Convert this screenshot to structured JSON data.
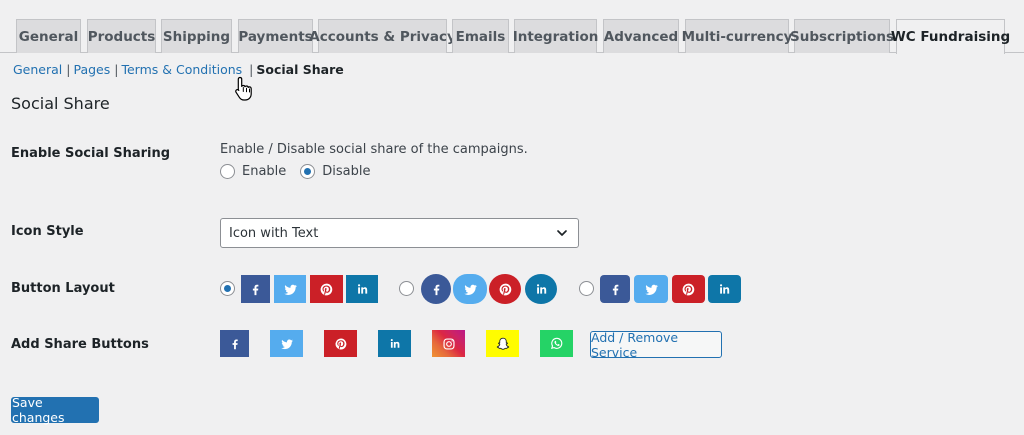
{
  "tabs": [
    {
      "label": "General"
    },
    {
      "label": "Products"
    },
    {
      "label": "Shipping"
    },
    {
      "label": "Payments"
    },
    {
      "label": "Accounts & Privacy"
    },
    {
      "label": "Emails"
    },
    {
      "label": "Integration"
    },
    {
      "label": "Advanced"
    },
    {
      "label": "Multi-currency"
    },
    {
      "label": "Subscriptions"
    },
    {
      "label": "WC Fundraising",
      "active": true
    }
  ],
  "subnav": {
    "general": "General",
    "pages": "Pages",
    "terms": "Terms & Conditions",
    "social_share": "Social Share",
    "separator": "|"
  },
  "section_title": "Social Share",
  "enable_sharing": {
    "label": "Enable Social Sharing",
    "description": "Enable / Disable social share of the campaigns.",
    "enable_label": "Enable",
    "disable_label": "Disable",
    "selected": "Disable"
  },
  "icon_style": {
    "label": "Icon Style",
    "value": "Icon with Text"
  },
  "button_layout": {
    "label": "Button Layout",
    "selected_index": 0
  },
  "share_buttons": {
    "label": "Add Share Buttons",
    "services": [
      "facebook",
      "twitter",
      "pinterest",
      "linkedin",
      "instagram",
      "snapchat",
      "whatsapp"
    ],
    "add_remove_label": "Add / Remove Service"
  },
  "save_label": "Save changes",
  "colors": {
    "facebook": "#3b5998",
    "twitter": "#55acee",
    "pinterest": "#cb2027",
    "linkedin": "#0e76a8",
    "whatsapp": "#25d366",
    "snapchat": "#fffc00",
    "accent": "#2271b1"
  }
}
